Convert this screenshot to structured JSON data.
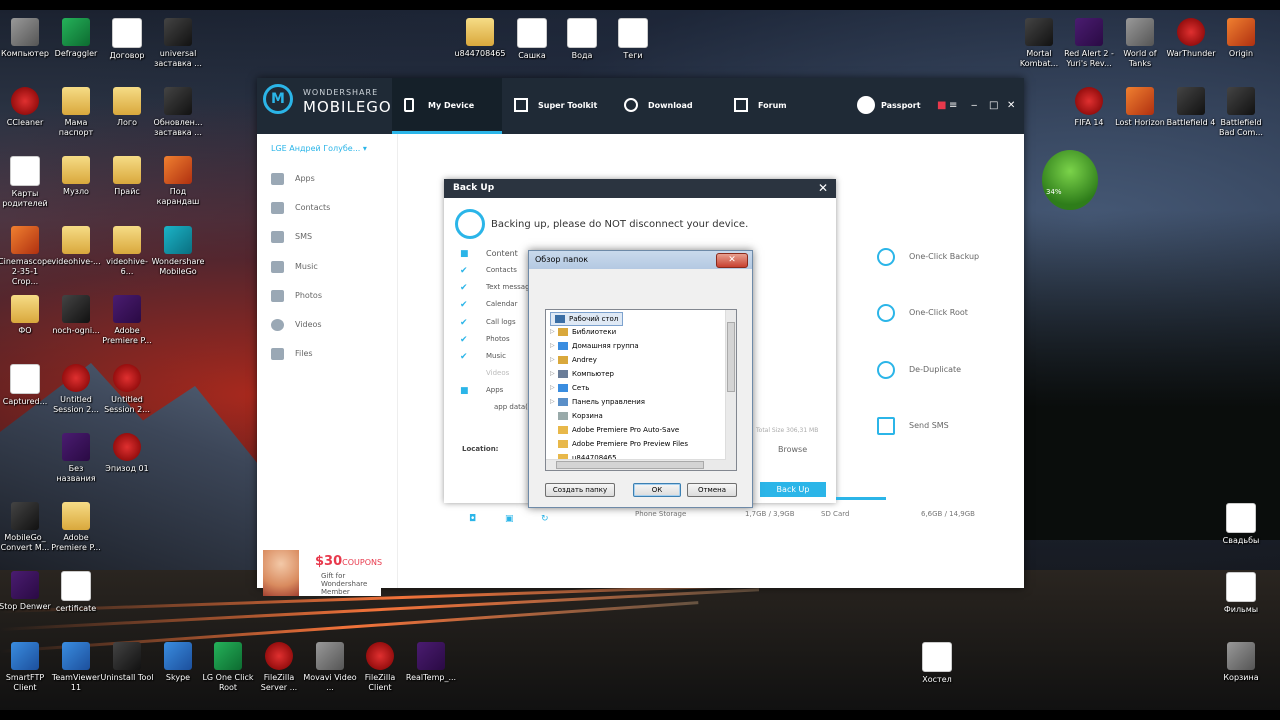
{
  "desktop": {
    "icons_left": [
      {
        "label": "Компьютер",
        "style": "gray"
      },
      {
        "label": "Defraggler",
        "style": "green"
      },
      {
        "label": "Договор",
        "style": "doc"
      },
      {
        "label": "universal заставка ...",
        "style": "dark"
      },
      {
        "label": "CCleaner",
        "style": "red"
      },
      {
        "label": "Мама паспорт",
        "style": "folder"
      },
      {
        "label": "Лого",
        "style": "folder"
      },
      {
        "label": "Обновлен... заставка ...",
        "style": "dark"
      },
      {
        "label": "Карты родителей",
        "style": "doc"
      },
      {
        "label": "Музло",
        "style": "folder"
      },
      {
        "label": "Прайс",
        "style": "folder"
      },
      {
        "label": "Под карандаш",
        "style": "orange"
      },
      {
        "label": "Cinemascope 2-35-1 Crop...",
        "style": "orange"
      },
      {
        "label": "videohive-...",
        "style": "folder"
      },
      {
        "label": "videohive-6...",
        "style": "folder"
      },
      {
        "label": "Wondershare MobileGo",
        "style": "teal"
      },
      {
        "label": "ФО",
        "style": "folder"
      },
      {
        "label": "noch-ogni...",
        "style": "dark"
      },
      {
        "label": "Adobe Premiere P...",
        "style": "purple"
      },
      {
        "label": "Captured...",
        "style": "doc"
      },
      {
        "label": "Untitled Session 2...",
        "style": "red"
      },
      {
        "label": "Untitled Session 2...",
        "style": "red"
      },
      {
        "label": "Без названия",
        "style": "purple"
      },
      {
        "label": "Эпизод 01",
        "style": "red"
      },
      {
        "label": "MobileGo_ Convert M...",
        "style": "dark"
      },
      {
        "label": "Adobe Premiere P...",
        "style": "folder"
      },
      {
        "label": "Stop Denwer",
        "style": "purple"
      },
      {
        "label": "certificate",
        "style": "doc"
      }
    ],
    "icons_top": [
      {
        "label": "u844708465",
        "style": "folder"
      },
      {
        "label": "Сашка",
        "style": "doc"
      },
      {
        "label": "Вода",
        "style": "doc"
      },
      {
        "label": "Теги",
        "style": "doc"
      }
    ],
    "icons_right": [
      {
        "label": "Mortal Kombat...",
        "style": "dark"
      },
      {
        "label": "Red Alert 2 - Yuri's Rev...",
        "style": "purple"
      },
      {
        "label": "World of Tanks",
        "style": "gray"
      },
      {
        "label": "WarThunder",
        "style": "red"
      },
      {
        "label": "Origin",
        "style": "orange"
      },
      {
        "label": "FIFA 14",
        "style": "red"
      },
      {
        "label": "Lost Horizon",
        "style": "orange"
      },
      {
        "label": "Battlefield 4",
        "style": "dark"
      },
      {
        "label": "Battlefield Bad Com...",
        "style": "dark"
      },
      {
        "label": "Свадьбы",
        "style": "doc"
      },
      {
        "label": "Фильмы",
        "style": "doc"
      },
      {
        "label": "Хостел",
        "style": "doc"
      },
      {
        "label": "Корзина",
        "style": "gray"
      }
    ],
    "icons_bottom": [
      {
        "label": "SmartFTP Client",
        "style": "blue"
      },
      {
        "label": "TeamViewer 11",
        "style": "blue"
      },
      {
        "label": "Uninstall Tool",
        "style": "dark"
      },
      {
        "label": "Skype",
        "style": "blue"
      },
      {
        "label": "LG One Click Root",
        "style": "green"
      },
      {
        "label": "FileZilla Server ...",
        "style": "red"
      },
      {
        "label": "Movavi Video ...",
        "style": "gray"
      },
      {
        "label": "FileZilla Client",
        "style": "red"
      },
      {
        "label": "RealTemp_...",
        "style": "purple"
      }
    ],
    "widget_percent": "34%"
  },
  "mobilego": {
    "brand_top": "WONDERSHARE",
    "brand_main": "MOBILEGO",
    "tabs": [
      "My Device",
      "Super Toolkit",
      "Download",
      "Forum"
    ],
    "passport": "Passport",
    "device": "LGE Андрей Голубе...",
    "sidebar": [
      "Apps",
      "Contacts",
      "SMS",
      "Music",
      "Photos",
      "Videos",
      "Files"
    ],
    "actions": [
      "One-Click Backup",
      "One-Click Root",
      "De-Duplicate",
      "Send SMS"
    ],
    "coupon": {
      "amount": "$30",
      "label": "COUPONS",
      "line1": "Gift for",
      "line2": "Wondershare",
      "line3": "Member"
    },
    "storage": {
      "phone_label": "Phone Storage",
      "phone_value": "1,7GB / 3,9GB",
      "sd_label": "SD Card",
      "sd_value": "6,6GB / 14,9GB"
    }
  },
  "backup": {
    "title": "Back Up",
    "message": "Backing up, please do NOT disconnect your device.",
    "items": [
      "Content",
      "Contacts",
      "Text messages",
      "Calendar",
      "Call logs",
      "Photos",
      "Music",
      "Videos",
      "Apps",
      "app data(..."
    ],
    "total_size": "Total Size 306,31 MB",
    "location_label": "Location:",
    "browse": "Browse",
    "button": "Back Up"
  },
  "browse_dialog": {
    "title": "Обзор папок",
    "tree": [
      "Рабочий стол",
      "Библиотеки",
      "Домашняя группа",
      "Andrey",
      "Компьютер",
      "Сеть",
      "Панель управления",
      "Корзина",
      "Adobe Premiere Pro Auto-Save",
      "Adobe Premiere Pro Preview Files",
      "u844708465"
    ],
    "new_folder": "Создать папку",
    "ok": "ОК",
    "cancel": "Отмена"
  }
}
